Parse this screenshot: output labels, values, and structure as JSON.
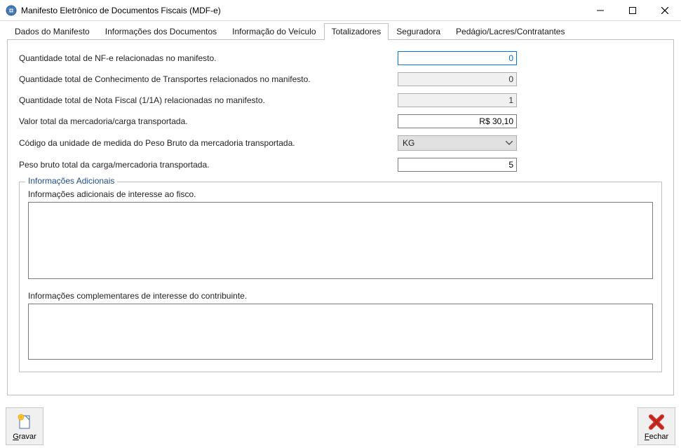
{
  "window": {
    "title": "Manifesto Eletrônico de Documentos Fiscais (MDF-e)"
  },
  "tabs": [
    {
      "label": "Dados do Manifesto"
    },
    {
      "label": "Informações dos Documentos"
    },
    {
      "label": "Informação do Veículo"
    },
    {
      "label": "Totalizadores"
    },
    {
      "label": "Seguradora"
    },
    {
      "label": "Pedágio/Lacres/Contratantes"
    }
  ],
  "active_tab_index": 3,
  "totalizadores": {
    "rows": [
      {
        "label": "Quantidade total de NF-e  relacionadas no manifesto.",
        "value": "0",
        "focused": true,
        "readonly": false
      },
      {
        "label": "Quantidade total de Conhecimento de Transportes relacionados no manifesto.",
        "value": "0",
        "focused": false,
        "readonly": true
      },
      {
        "label": "Quantidade total de Nota Fiscal (1/1A)  relacionadas no manifesto.",
        "value": "1",
        "focused": false,
        "readonly": true
      },
      {
        "label": "Valor total da mercadoria/carga transportada.",
        "value": "R$ 30,10",
        "focused": false,
        "readonly": false
      },
      {
        "label": "Código da unidade de medida do Peso Bruto da mercadoria transportada.",
        "value": "KG",
        "type": "combo"
      },
      {
        "label": "Peso bruto total da carga/mercadoria transportada.",
        "value": "5",
        "focused": false,
        "readonly": false
      }
    ],
    "fieldset_legend": "Informações Adicionais",
    "fisco_label": "Informações adicionais de interesse ao fisco.",
    "fisco_value": "",
    "contrib_label": "Informações complementares de interesse do contribuinte.",
    "contrib_value": ""
  },
  "buttons": {
    "gravar": "Gravar",
    "fechar": "Fechar"
  }
}
